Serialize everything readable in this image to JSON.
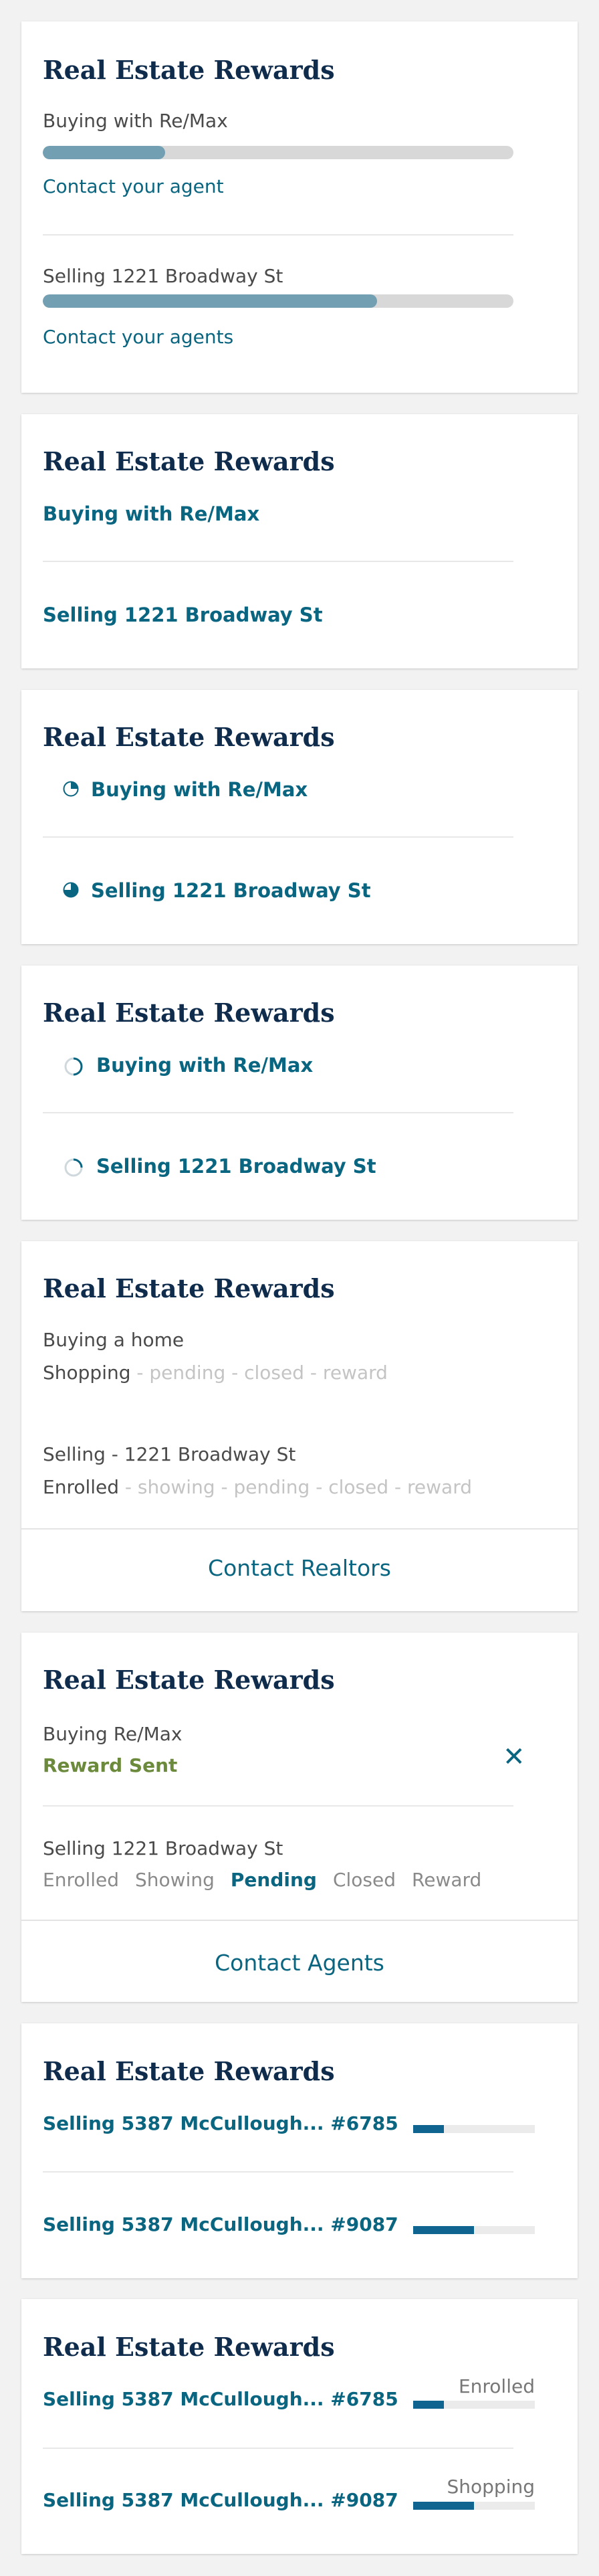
{
  "card1": {
    "title": "Real Estate Rewards",
    "items": [
      {
        "label": "Buying with Re/Max",
        "progress": 0.26,
        "link": "Contact your agent"
      },
      {
        "label": "Selling 1221 Broadway St",
        "progress": 0.71,
        "link": "Contact your agents"
      }
    ]
  },
  "card2": {
    "title": "Real Estate Rewards",
    "items": [
      {
        "label": "Buying with Re/Max"
      },
      {
        "label": "Selling 1221 Broadway St"
      }
    ]
  },
  "card3": {
    "title": "Real Estate Rewards",
    "items": [
      {
        "label": "Buying with Re/Max",
        "icon": "pie-quarter-icon",
        "progress": 0.25
      },
      {
        "label": "Selling 1221 Broadway St",
        "icon": "pie-three-quarter-icon",
        "progress": 0.75
      }
    ]
  },
  "card4": {
    "title": "Real Estate Rewards",
    "items": [
      {
        "label": "Buying with Re/Max",
        "icon": "progress-ring-icon",
        "progress": 0.5
      },
      {
        "label": "Selling 1221 Broadway St",
        "icon": "progress-ring-icon",
        "progress": 0.25
      }
    ]
  },
  "card5": {
    "title": "Real Estate Rewards",
    "items": [
      {
        "label": "Buying a home",
        "current": "Shopping",
        "rest": " - pending - closed - reward"
      },
      {
        "label": "Selling - 1221 Broadway St",
        "current": "Enrolled",
        "rest": " - showing - pending - closed - reward"
      }
    ],
    "button": "Contact Realtors"
  },
  "card6": {
    "title": "Real Estate Rewards",
    "buying_label": "Buying Re/Max",
    "buying_status": "Reward Sent",
    "selling_label": "Selling 1221 Broadway St",
    "steps": [
      "Enrolled",
      "Showing",
      "Pending",
      "Closed",
      "Reward"
    ],
    "active_step": "Pending",
    "button": "Contact Agents"
  },
  "card7": {
    "title": "Real Estate Rewards",
    "items": [
      {
        "label": "Selling 5387 McCullough... #6785",
        "progress": 0.25
      },
      {
        "label": "Selling 5387 McCullough...  #9087",
        "progress": 0.5
      }
    ]
  },
  "card8": {
    "title": "Real Estate Rewards",
    "items": [
      {
        "label": "Selling 5387 McCullough... #6785",
        "status": "Enrolled",
        "progress": 0.25
      },
      {
        "label": "Selling 5387 McCullough...  #9087",
        "status": "Shopping",
        "progress": 0.5
      }
    ]
  },
  "colors": {
    "title": "#0f2c4c",
    "link": "#0a6580",
    "bar_fill": "#739fb2",
    "mini_fill": "#0f6590",
    "success": "#6b8a3c",
    "muted": "#c4c4c4"
  }
}
